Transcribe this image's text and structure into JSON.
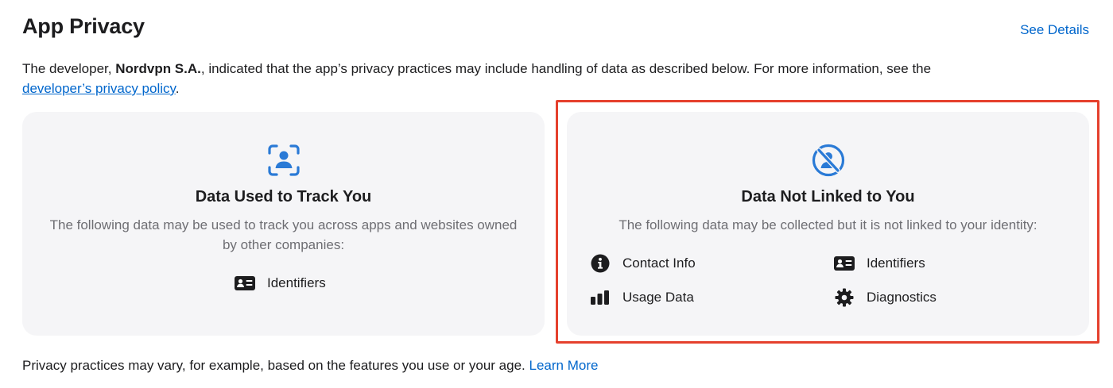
{
  "header": {
    "title": "App Privacy",
    "see_details": "See Details"
  },
  "description": {
    "prefix": "The developer, ",
    "developer": "Nordvpn S.A.",
    "middle": ", indicated that the app’s privacy practices may include handling of data as described below. For more information, see the ",
    "policy_link": "developer’s privacy policy",
    "suffix": "."
  },
  "cards": [
    {
      "icon": "tracking-icon",
      "title": "Data Used to Track You",
      "subtitle": "The following data may be used to track you across apps and websites owned by other companies:",
      "items": [
        {
          "icon": "id-card-icon",
          "label": "Identifiers"
        }
      ]
    },
    {
      "icon": "not-linked-icon",
      "title": "Data Not Linked to You",
      "subtitle": "The following data may be collected but it is not linked to your identity:",
      "items": [
        {
          "icon": "info-icon",
          "label": "Contact Info"
        },
        {
          "icon": "id-card-icon",
          "label": "Identifiers"
        },
        {
          "icon": "bar-chart-icon",
          "label": "Usage Data"
        },
        {
          "icon": "gear-icon",
          "label": "Diagnostics"
        }
      ]
    }
  ],
  "footer": {
    "text": "Privacy practices may vary, for example, based on the features you use or your age. ",
    "learn_more": "Learn More"
  },
  "colors": {
    "accent": "#0066cc",
    "card_bg": "#f5f5f7",
    "highlight": "#e5402d",
    "icon_blue": "#2a7ad6"
  }
}
